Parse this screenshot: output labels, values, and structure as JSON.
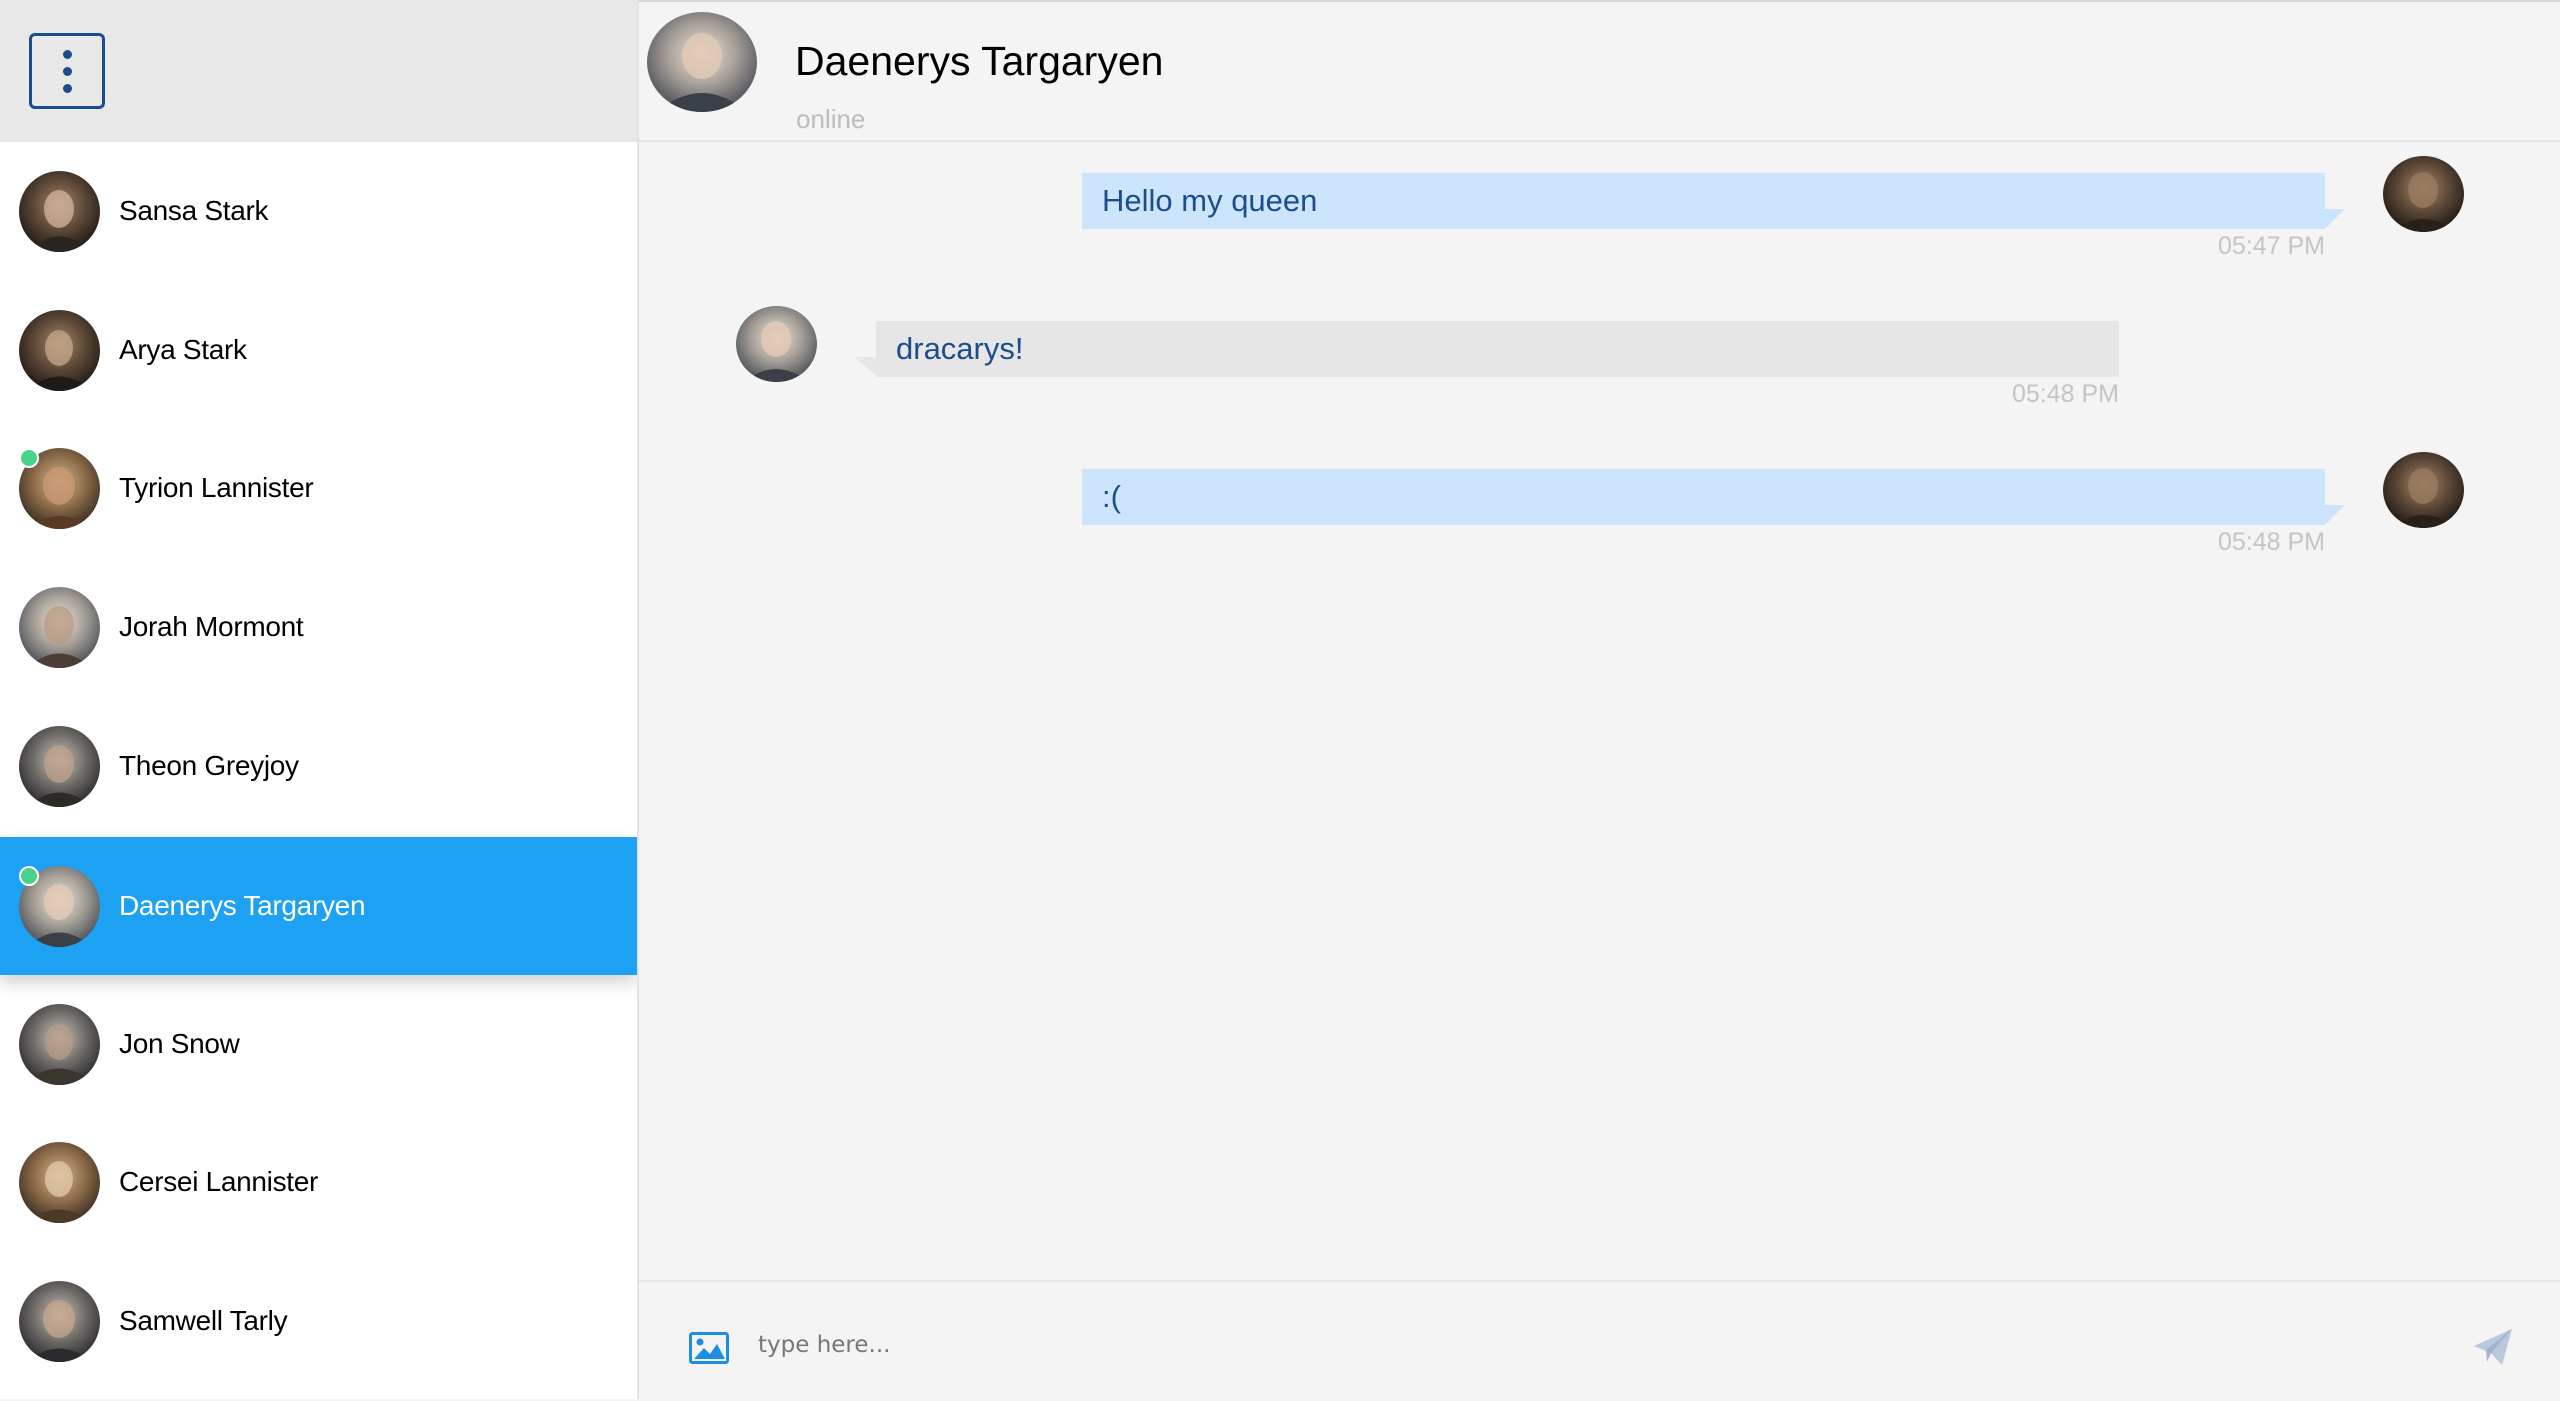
{
  "sidebar": {
    "menu_icon": "vertical-ellipsis-icon",
    "contacts": [
      {
        "name": "Sansa Stark",
        "online": false
      },
      {
        "name": "Arya Stark",
        "online": false
      },
      {
        "name": "Tyrion Lannister",
        "online": true
      },
      {
        "name": "Jorah Mormont",
        "online": false
      },
      {
        "name": "Theon Greyjoy",
        "online": false
      },
      {
        "name": "Daenerys Targaryen",
        "online": true,
        "active": true
      },
      {
        "name": "Jon Snow",
        "online": false
      },
      {
        "name": "Cersei Lannister",
        "online": false
      },
      {
        "name": "Samwell Tarly",
        "online": false
      }
    ]
  },
  "chat": {
    "title": "Daenerys Targaryen",
    "status": "online",
    "messages": [
      {
        "direction": "out",
        "text": "Hello my queen",
        "time": "05:47 PM"
      },
      {
        "direction": "in",
        "text": "dracarys!",
        "time": "05:48 PM"
      },
      {
        "direction": "out",
        "text": ":(",
        "time": "05:48 PM"
      }
    ]
  },
  "composer": {
    "placeholder": "type here...",
    "image_icon": "image-icon",
    "send_icon": "send-icon"
  },
  "colors": {
    "accent": "#1da1f2",
    "online": "#48d38a",
    "outgoing_bubble": "#cce4fc",
    "incoming_bubble": "#e6e6e6",
    "menu_border": "#1d4b8f"
  }
}
